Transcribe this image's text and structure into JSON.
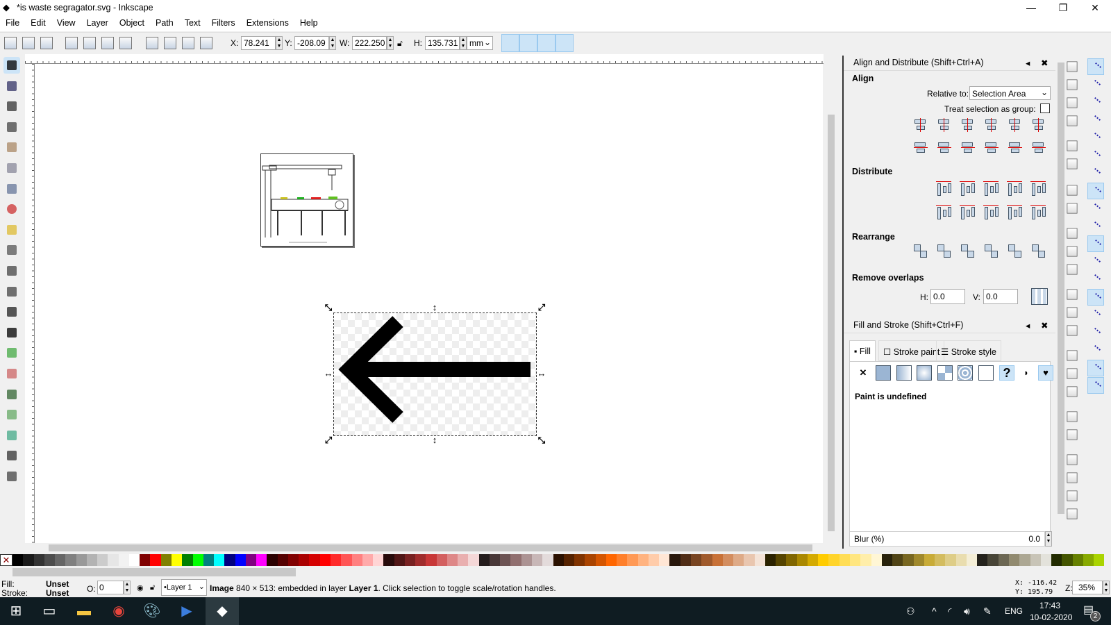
{
  "window": {
    "title": "*is waste segragator.svg - Inkscape",
    "minimize": "—",
    "maximize": "❐",
    "close": "✕"
  },
  "menu": [
    "File",
    "Edit",
    "View",
    "Layer",
    "Object",
    "Path",
    "Text",
    "Filters",
    "Extensions",
    "Help"
  ],
  "toolbar": {
    "x_label": "X:",
    "x": "78.241",
    "y_label": "Y:",
    "y": "-208.09",
    "w_label": "W:",
    "w": "222.250",
    "h_label": "H:",
    "h": "135.731",
    "unit": "mm"
  },
  "toolbox": [
    "selector",
    "node",
    "tweak",
    "zoom",
    "measure",
    "rectangle",
    "3d-box",
    "ellipse",
    "star",
    "spiral",
    "pencil",
    "pen",
    "calligraphy",
    "text",
    "spray",
    "eraser",
    "paint-bucket",
    "gradient",
    "mesh",
    "dropper",
    "connector"
  ],
  "align": {
    "title": "Align and Distribute (Shift+Ctrl+A)",
    "align_heading": "Align",
    "relative_label": "Relative to:",
    "relative_value": "Selection Area",
    "group_label": "Treat selection as group:",
    "group_checked": false,
    "distribute_heading": "Distribute",
    "rearrange_heading": "Rearrange",
    "overlaps_heading": "Remove overlaps",
    "h_label": "H:",
    "h_value": "0.0",
    "v_label": "V:",
    "v_value": "0.0"
  },
  "fill_stroke": {
    "title": "Fill and Stroke (Shift+Ctrl+F)",
    "tabs": [
      "Fill",
      "Stroke paint",
      "Stroke style"
    ],
    "active_tab": "Fill",
    "paint_buttons": [
      "none",
      "flat",
      "linear",
      "radial",
      "mesh",
      "pattern",
      "swatch",
      "unset",
      "evenodd",
      "nonzero"
    ],
    "message": "Paint is undefined",
    "blur_label": "Blur (%)",
    "blur_value": "0.0"
  },
  "palette": [
    "#000000",
    "#1a1a1a",
    "#333333",
    "#4d4d4d",
    "#666666",
    "#808080",
    "#999999",
    "#b3b3b3",
    "#cccccc",
    "#e6e6e6",
    "#f2f2f2",
    "#ffffff",
    "#800000",
    "#ff0000",
    "#808000",
    "#ffff00",
    "#008000",
    "#00ff00",
    "#008080",
    "#00ffff",
    "#000080",
    "#0000ff",
    "#800080",
    "#ff00ff",
    "#2b0000",
    "#550000",
    "#800000",
    "#aa0000",
    "#d40000",
    "#ff0000",
    "#ff2a2a",
    "#ff5555",
    "#ff8080",
    "#ffaaaa",
    "#ffd5d5",
    "#280b0b",
    "#501616",
    "#782121",
    "#a02c2c",
    "#c83737",
    "#d35f5f",
    "#de8787",
    "#e9afaf",
    "#f4d7d7",
    "#241c1c",
    "#483737",
    "#6c5353",
    "#916f6f",
    "#ac9393",
    "#c8b7b7",
    "#e3dbdb",
    "#2b1100",
    "#552200",
    "#803300",
    "#aa4400",
    "#d45500",
    "#ff6600",
    "#ff7f2a",
    "#ff9955",
    "#ffb380",
    "#ffccaa",
    "#ffe6d5",
    "#28170b",
    "#502d16",
    "#784421",
    "#a05a2c",
    "#c87137",
    "#d38d5f",
    "#deaa87",
    "#e9c6af",
    "#f4e3d7",
    "#2b2200",
    "#554400",
    "#806600",
    "#aa8800",
    "#d4aa00",
    "#ffcc00",
    "#ffd42a",
    "#ffdd55",
    "#ffe680",
    "#ffeeaa",
    "#fff6d5",
    "#28220b",
    "#504416",
    "#786721",
    "#a0892c",
    "#c8ab37",
    "#d3bc5f",
    "#decd87",
    "#e9ddaf",
    "#f4eed7",
    "#24221c",
    "#484537",
    "#6c6753",
    "#918a6f",
    "#aca793",
    "#c8c4b7",
    "#e3e2db",
    "#222b00",
    "#445500",
    "#668000",
    "#88aa00",
    "#aad400"
  ],
  "status": {
    "fill_label": "Fill:",
    "fill_value": "Unset",
    "stroke_label": "Stroke:",
    "stroke_value": "Unset",
    "opacity_label": "O:",
    "opacity_value": "0",
    "layer": "•Layer 1",
    "msg_bold1": "Image",
    "msg1": " 840 × 513: embedded in layer ",
    "msg_bold2": "Layer 1",
    "msg2": ". Click selection to toggle scale/rotation handles.",
    "cursor_x": "X: -116.42",
    "cursor_y": "Y:  195.79",
    "zoom_label": "Z:",
    "zoom": "35%"
  },
  "taskbar": {
    "lang": "ENG",
    "time": "17:43",
    "date": "10-02-2020",
    "notifications": "2"
  }
}
